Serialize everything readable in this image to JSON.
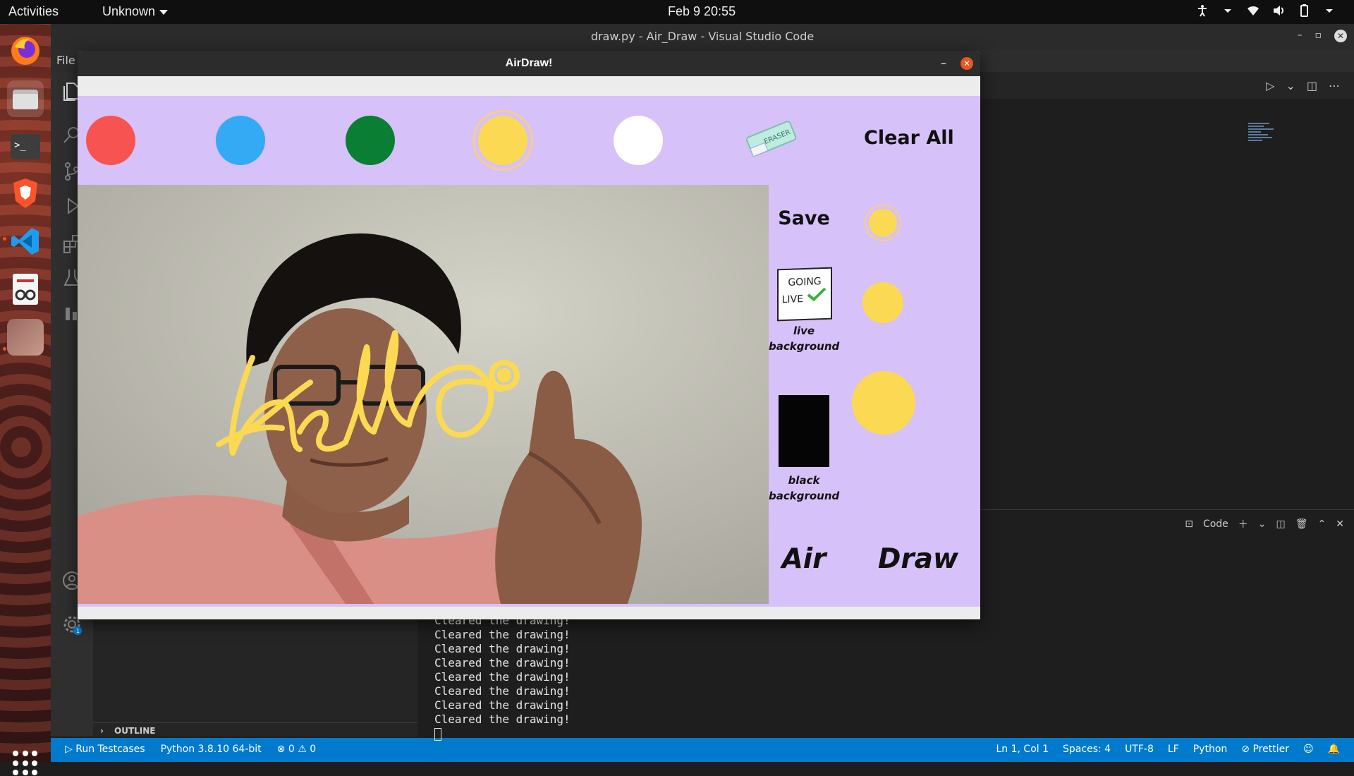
{
  "topbar": {
    "activities": "Activities",
    "app_menu": "Unknown",
    "clock": "Feb 9  20:55"
  },
  "vscode": {
    "window_title": "draw.py - Air_Draw - Visual Studio Code",
    "menu_file": "File",
    "outline_label": "OUTLINE",
    "panel_code_label": "Code",
    "terminal_lines": [
      "Cleared the drawing!",
      "Cleared the drawing!",
      "Cleared the drawing!",
      "Cleared the drawing!",
      "Cleared the drawing!",
      "Cleared the drawing!",
      "Cleared the drawing!",
      "Cleared the drawing!"
    ],
    "statusbar": {
      "run_testcases": "Run Testcases",
      "python_version": "Python 3.8.10 64-bit",
      "errors": "0",
      "warnings": "0",
      "cursor_position": "Ln 1, Col 1",
      "spaces": "Spaces: 4",
      "encoding": "UTF-8",
      "eol": "LF",
      "language": "Python",
      "formatter": "Prettier"
    }
  },
  "airdraw": {
    "window_title": "AirDraw!",
    "clear_all": "Clear All",
    "save": "Save",
    "live_thumb_text": "GOING LIVE",
    "live_caption_1": "live",
    "live_caption_2": "background",
    "black_caption_1": "black",
    "black_caption_2": "background",
    "eraser_text": "ERASER",
    "air": "Air",
    "draw": "Draw",
    "drawn_word": "hello",
    "colors": {
      "red": "#f75451",
      "blue": "#34aaf4",
      "green": "#0a7f34",
      "yellow": "#fcd953",
      "white": "#ffffff",
      "panel_bg": "#d6c1f8"
    },
    "selected_color": "yellow",
    "brush_sizes": [
      "small",
      "medium",
      "large"
    ],
    "selected_brush_size": "small"
  }
}
